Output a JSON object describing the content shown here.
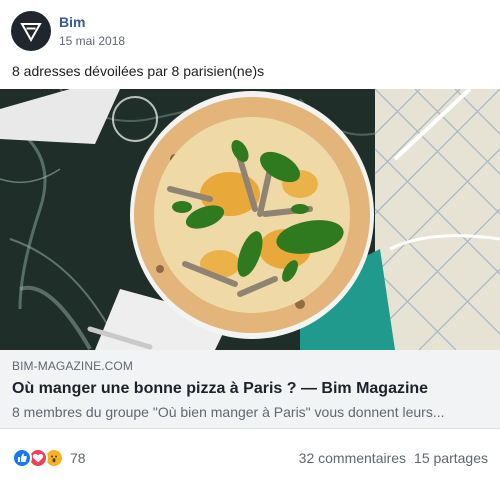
{
  "post": {
    "author": "Bim",
    "date": "15 mai 2018",
    "message": "8 adresses dévoilées par 8 parisien(ne)s",
    "avatar_icon": "triangle-logo-icon"
  },
  "link": {
    "domain": "BIM-MAGAZINE.COM",
    "title": "Où manger une bonne pizza à Paris ? — Bim Magazine",
    "description": "8 membres du groupe \"Où bien manger à Paris\" vous donnent leurs..."
  },
  "footer": {
    "reactions": [
      "like-icon",
      "love-icon",
      "wow-icon"
    ],
    "reaction_count": "78",
    "comments": "32 commentaires",
    "shares": "15 partages"
  },
  "colors": {
    "author": "#385898",
    "link_bg": "#f2f3f5",
    "like": "#1877f2",
    "love": "#f33e58",
    "wow": "#f7b125"
  }
}
